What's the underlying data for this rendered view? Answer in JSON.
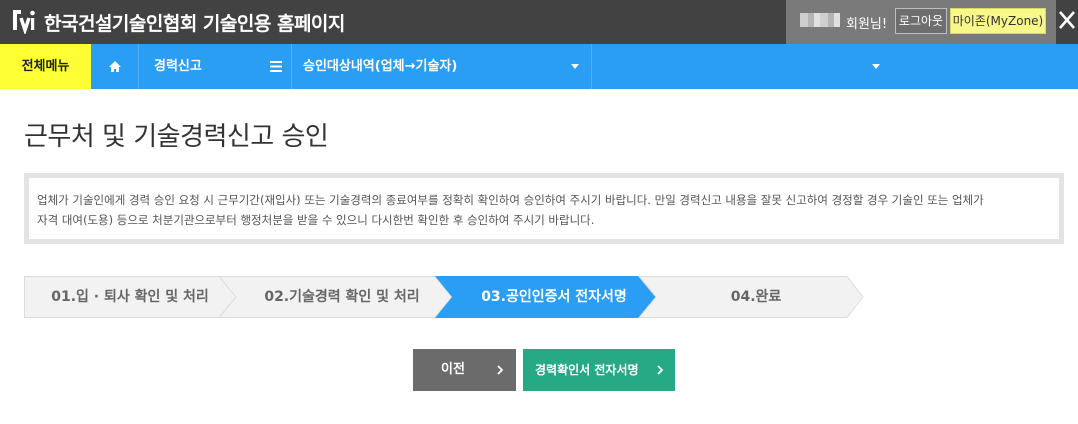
{
  "header": {
    "site_title": "한국건설기술인협회 기술인용 홈페이지",
    "user_suffix": "회원님!",
    "logout_label": "로그아웃",
    "myzone_label": "마이존(MyZone)",
    "logo_icon": "kocea-logo-icon",
    "close_icon": "close-icon"
  },
  "nav": {
    "all_menu_label": "전체메뉴",
    "home_icon": "home-icon",
    "career_label": "경력신고",
    "menu_icon": "hamburger-menu-icon",
    "approval_label": "승인대상내역(업체→기술자)",
    "second_dropdown_label": ""
  },
  "main": {
    "page_title": "근무처 및 기술경력신고 승인",
    "notice_line1": "업체가 기술인에게 경력 승인 요청 시 근무기간(재입사) 또는 기술경력의 종료여부를 정확히 확인하여 승인하여 주시기 바랍니다. 만일 경력신고 내용을 잘못 신고하여 경정할 경우 기술인 또는 업체가",
    "notice_line2": "자격 대여(도용) 등으로 처분기관으로부터 행정처분을 받을 수 있으니 다시한번 확인한 후 승인하여 주시기 바랍니다."
  },
  "steps": [
    {
      "label": "01.입 · 퇴사 확인 및 처리",
      "active": false
    },
    {
      "label": "02.기술경력 확인 및 처리",
      "active": false
    },
    {
      "label": "03.공인인증서 전자서명",
      "active": true
    },
    {
      "label": "04.완료",
      "active": false
    }
  ],
  "buttons": {
    "prev_label": "이전",
    "sign_label": "경력확인서 전자서명"
  },
  "colors": {
    "header_bg": "#424242",
    "nav_bg": "#2a9ef5",
    "all_menu_bg": "#fefe35",
    "active_step": "#2a9ef5",
    "prev_button": "#6b6b6b",
    "sign_button": "#26a985",
    "myzone_bg": "#f7f78a"
  }
}
